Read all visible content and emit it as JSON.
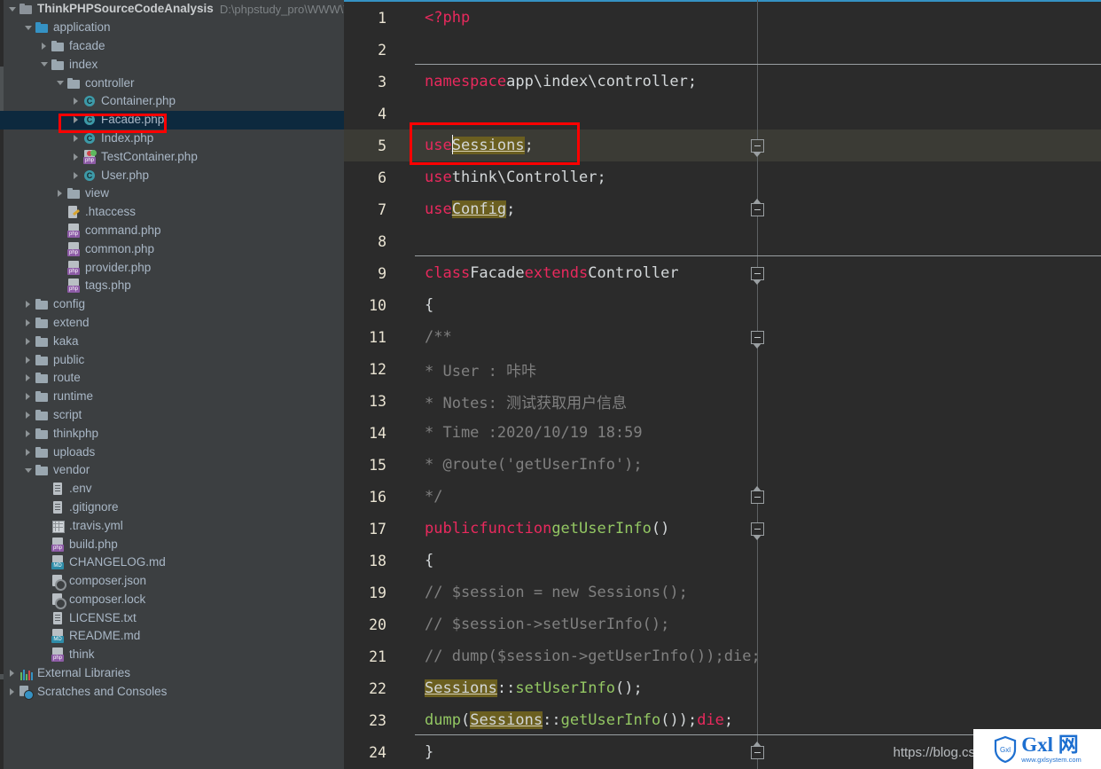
{
  "window": {
    "title": "ThinkPHPSourceCodeAnalysis",
    "project_path": "D:\\phpstudy_pro\\WWW\\Th"
  },
  "sidebar": {
    "items": [
      {
        "label": "ThinkPHPSourceCodeAnalysis",
        "path_suffix": "D:\\phpstudy_pro\\WWW\\Th",
        "indent": 0,
        "twist": "down",
        "icon": "folder-project-icon",
        "kind": "project",
        "selected": false
      },
      {
        "label": "application",
        "indent": 1,
        "twist": "down",
        "icon": "folder-module-icon",
        "kind": "module",
        "selected": false
      },
      {
        "label": "facade",
        "indent": 2,
        "twist": "right",
        "icon": "folder-icon",
        "kind": "folder",
        "selected": false
      },
      {
        "label": "index",
        "indent": 2,
        "twist": "down",
        "icon": "folder-icon",
        "kind": "folder",
        "selected": false
      },
      {
        "label": "controller",
        "indent": 3,
        "twist": "down",
        "icon": "folder-icon",
        "kind": "folder",
        "selected": false
      },
      {
        "label": "Container.php",
        "indent": 4,
        "twist": "right",
        "icon": "php-class-icon",
        "kind": "class",
        "selected": false
      },
      {
        "label": "Facade.php",
        "indent": 4,
        "twist": "right",
        "icon": "php-class-icon",
        "kind": "class",
        "selected": true
      },
      {
        "label": "Index.php",
        "indent": 4,
        "twist": "right",
        "icon": "php-class-icon",
        "kind": "class",
        "selected": false
      },
      {
        "label": "TestContainer.php",
        "indent": 4,
        "twist": "right",
        "icon": "php-test-file-icon",
        "kind": "phptest",
        "selected": false
      },
      {
        "label": "User.php",
        "indent": 4,
        "twist": "right",
        "icon": "php-class-icon",
        "kind": "class",
        "selected": false
      },
      {
        "label": "view",
        "indent": 3,
        "twist": "right",
        "icon": "folder-icon",
        "kind": "folder",
        "selected": false
      },
      {
        "label": ".htaccess",
        "indent": 3,
        "twist": "none",
        "icon": "htaccess-file-icon",
        "kind": "htaccess",
        "selected": false
      },
      {
        "label": "command.php",
        "indent": 3,
        "twist": "none",
        "icon": "php-file-icon",
        "kind": "php",
        "selected": false
      },
      {
        "label": "common.php",
        "indent": 3,
        "twist": "none",
        "icon": "php-file-icon",
        "kind": "php",
        "selected": false
      },
      {
        "label": "provider.php",
        "indent": 3,
        "twist": "none",
        "icon": "php-file-icon",
        "kind": "php",
        "selected": false
      },
      {
        "label": "tags.php",
        "indent": 3,
        "twist": "none",
        "icon": "php-file-icon",
        "kind": "php",
        "selected": false
      },
      {
        "label": "config",
        "indent": 1,
        "twist": "right",
        "icon": "folder-icon",
        "kind": "folder",
        "selected": false
      },
      {
        "label": "extend",
        "indent": 1,
        "twist": "right",
        "icon": "folder-icon",
        "kind": "folder",
        "selected": false
      },
      {
        "label": "kaka",
        "indent": 1,
        "twist": "right",
        "icon": "folder-icon",
        "kind": "folder",
        "selected": false
      },
      {
        "label": "public",
        "indent": 1,
        "twist": "right",
        "icon": "folder-icon",
        "kind": "folder",
        "selected": false
      },
      {
        "label": "route",
        "indent": 1,
        "twist": "right",
        "icon": "folder-icon",
        "kind": "folder",
        "selected": false
      },
      {
        "label": "runtime",
        "indent": 1,
        "twist": "right",
        "icon": "folder-icon",
        "kind": "folder",
        "selected": false
      },
      {
        "label": "script",
        "indent": 1,
        "twist": "right",
        "icon": "folder-icon",
        "kind": "folder",
        "selected": false
      },
      {
        "label": "thinkphp",
        "indent": 1,
        "twist": "right",
        "icon": "folder-icon",
        "kind": "folder",
        "selected": false
      },
      {
        "label": "uploads",
        "indent": 1,
        "twist": "right",
        "icon": "folder-icon",
        "kind": "folder",
        "selected": false
      },
      {
        "label": "vendor",
        "indent": 1,
        "twist": "down",
        "icon": "folder-icon",
        "kind": "folder",
        "selected": false
      },
      {
        "label": ".env",
        "indent": 2,
        "twist": "none",
        "icon": "text-file-icon",
        "kind": "file",
        "selected": false
      },
      {
        "label": ".gitignore",
        "indent": 2,
        "twist": "none",
        "icon": "text-file-icon",
        "kind": "file",
        "selected": false
      },
      {
        "label": ".travis.yml",
        "indent": 2,
        "twist": "none",
        "icon": "yaml-file-icon",
        "kind": "yml",
        "selected": false
      },
      {
        "label": "build.php",
        "indent": 2,
        "twist": "none",
        "icon": "php-file-icon",
        "kind": "php",
        "selected": false
      },
      {
        "label": "CHANGELOG.md",
        "indent": 2,
        "twist": "none",
        "icon": "markdown-file-icon",
        "kind": "md",
        "selected": false
      },
      {
        "label": "composer.json",
        "indent": 2,
        "twist": "none",
        "icon": "composer-file-icon",
        "kind": "json",
        "selected": false
      },
      {
        "label": "composer.lock",
        "indent": 2,
        "twist": "none",
        "icon": "composer-file-icon",
        "kind": "json",
        "selected": false
      },
      {
        "label": "LICENSE.txt",
        "indent": 2,
        "twist": "none",
        "icon": "text-file-icon",
        "kind": "file",
        "selected": false
      },
      {
        "label": "README.md",
        "indent": 2,
        "twist": "none",
        "icon": "markdown-file-icon",
        "kind": "md",
        "selected": false
      },
      {
        "label": "think",
        "indent": 2,
        "twist": "none",
        "icon": "php-file-icon",
        "kind": "php",
        "selected": false
      },
      {
        "label": "External Libraries",
        "indent": 0,
        "twist": "right",
        "icon": "external-libraries-icon",
        "kind": "libs",
        "selected": false
      },
      {
        "label": "Scratches and Consoles",
        "indent": 0,
        "twist": "right",
        "icon": "scratches-icon",
        "kind": "scratch",
        "selected": false
      }
    ]
  },
  "editor": {
    "lines": [
      {
        "n": "1",
        "text": "<?php"
      },
      {
        "n": "2",
        "text": ""
      },
      {
        "n": "3",
        "text": "namespace app\\index\\controller;"
      },
      {
        "n": "4",
        "text": ""
      },
      {
        "n": "5",
        "text": "use Sessions;",
        "highlighted": true
      },
      {
        "n": "6",
        "text": "use think\\Controller;"
      },
      {
        "n": "7",
        "text": "use Config;"
      },
      {
        "n": "8",
        "text": ""
      },
      {
        "n": "9",
        "text": "class Facade extends Controller"
      },
      {
        "n": "10",
        "text": "{"
      },
      {
        "n": "11",
        "text": "    /**"
      },
      {
        "n": "12",
        "text": "     * User : 咔咔"
      },
      {
        "n": "13",
        "text": "     * Notes: 测试获取用户信息"
      },
      {
        "n": "14",
        "text": "     * Time :2020/10/19 18:59"
      },
      {
        "n": "15",
        "text": "     * @route('getUserInfo');"
      },
      {
        "n": "16",
        "text": "     */"
      },
      {
        "n": "17",
        "text": "    public function getUserInfo()"
      },
      {
        "n": "18",
        "text": "    {"
      },
      {
        "n": "19",
        "text": "        // $session = new Sessions();"
      },
      {
        "n": "20",
        "text": "        // $session->setUserInfo();"
      },
      {
        "n": "21",
        "text": "        // dump($session->getUserInfo());die;"
      },
      {
        "n": "22",
        "text": "        Sessions::setUserInfo();"
      },
      {
        "n": "23",
        "text": "        dump(Sessions::getUserInfo());die;"
      },
      {
        "n": "24",
        "text": "    }"
      }
    ],
    "highlighted_tokens": [
      "Sessions",
      "Config"
    ],
    "caret_line": "5"
  },
  "annotations": [
    {
      "name": "facade-file-highlight-box",
      "color": "#ff0000"
    },
    {
      "name": "use-sessions-highlight-box",
      "color": "#ff0000"
    }
  ],
  "watermark": {
    "url": "https://blog.csdn.net/nanhuaibeian",
    "logo_badge": "Gxl",
    "logo_main": "Gxl 网",
    "logo_sub": "www.gxlsystem.com"
  },
  "colors": {
    "sidebar_bg": "#3c3f41",
    "editor_bg": "#2b2b2b",
    "selection_bg": "#0d293e",
    "current_line_bg": "#3b3b35",
    "keyword": "#e8295d",
    "function": "#93c763",
    "comment": "#808080",
    "identifier_highlight": "#6b5f20",
    "accent": "#3592c4"
  }
}
